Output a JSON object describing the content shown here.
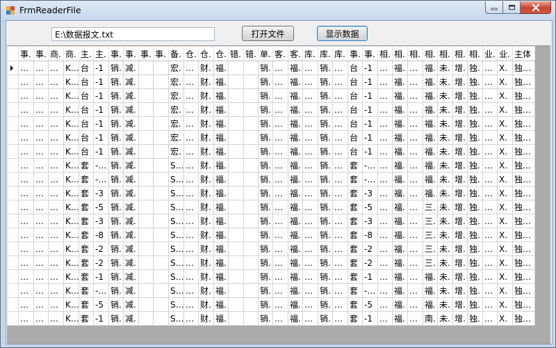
{
  "window": {
    "title": "FrmReaderFile"
  },
  "toolbar": {
    "file_path": "E:\\数据报文.txt",
    "open_button": "打开文件",
    "show_button": "显示数据"
  },
  "grid": {
    "columns": [
      "事.",
      "事.",
      "商.",
      "商.",
      "主.",
      "主.",
      "事.",
      "事.",
      "事.",
      "事.",
      "备.",
      "仓.",
      "仓.",
      "仓.",
      "错.",
      "错.",
      "单.",
      "客.",
      "客.",
      "库.",
      "库.",
      "库.",
      "事.",
      "事.",
      "相.",
      "相.",
      "相.",
      "相.",
      "相.",
      "相.",
      "相.",
      "业.",
      "业.",
      "主体"
    ],
    "current_row": 0,
    "rows": [
      [
        "…",
        "…",
        "…",
        "K…",
        "台",
        "-1",
        "销.",
        "减.",
        "",
        "",
        "宏.",
        "…",
        "财.",
        "福.",
        "",
        "",
        "销.",
        "…",
        "福.",
        "…",
        "销.",
        "…",
        "台",
        "-1",
        "…",
        "福.",
        "…",
        "福.",
        "未.",
        "增.",
        "独.",
        "…",
        "X.",
        "独…"
      ],
      [
        "…",
        "…",
        "…",
        "K…",
        "台",
        "-1",
        "销.",
        "减.",
        "",
        "",
        "宏.",
        "…",
        "财.",
        "福.",
        "",
        "",
        "销.",
        "…",
        "福.",
        "…",
        "销.",
        "…",
        "台",
        "-1",
        "…",
        "福.",
        "…",
        "福.",
        "未.",
        "增.",
        "独.",
        "…",
        "X.",
        "独…"
      ],
      [
        "…",
        "…",
        "…",
        "K…",
        "台",
        "-1",
        "销.",
        "减.",
        "",
        "",
        "宏.",
        "…",
        "财.",
        "福.",
        "",
        "",
        "销.",
        "…",
        "福.",
        "…",
        "销.",
        "…",
        "台",
        "-1",
        "…",
        "福.",
        "…",
        "福.",
        "未.",
        "增.",
        "独.",
        "…",
        "X.",
        "独…"
      ],
      [
        "…",
        "…",
        "…",
        "K…",
        "台",
        "-1",
        "销.",
        "减.",
        "",
        "",
        "宏.",
        "…",
        "财.",
        "福.",
        "",
        "",
        "销.",
        "…",
        "福.",
        "…",
        "销.",
        "…",
        "台",
        "-1",
        "…",
        "福.",
        "…",
        "福.",
        "未.",
        "增.",
        "独.",
        "…",
        "X.",
        "独…"
      ],
      [
        "…",
        "…",
        "…",
        "K…",
        "台",
        "-1",
        "销.",
        "减.",
        "",
        "",
        "宏.",
        "…",
        "财.",
        "福.",
        "",
        "",
        "销.",
        "…",
        "福.",
        "…",
        "销.",
        "…",
        "台",
        "-1",
        "…",
        "福.",
        "…",
        "福.",
        "未.",
        "增.",
        "独.",
        "…",
        "X.",
        "独…"
      ],
      [
        "…",
        "…",
        "…",
        "K…",
        "台",
        "-1",
        "销.",
        "减.",
        "",
        "",
        "宏.",
        "…",
        "财.",
        "福.",
        "",
        "",
        "销.",
        "…",
        "福.",
        "…",
        "销.",
        "…",
        "台",
        "-1",
        "…",
        "福.",
        "…",
        "福.",
        "未.",
        "增.",
        "独.",
        "…",
        "X.",
        "独…"
      ],
      [
        "…",
        "…",
        "…",
        "K…",
        "台",
        "-1",
        "销.",
        "减.",
        "",
        "",
        "宏.",
        "…",
        "财.",
        "福.",
        "",
        "",
        "销.",
        "…",
        "福.",
        "…",
        "销.",
        "…",
        "台",
        "-1",
        "…",
        "福.",
        "…",
        "福.",
        "未.",
        "增.",
        "独.",
        "…",
        "X.",
        "独…"
      ],
      [
        "…",
        "…",
        "…",
        "K…",
        "套",
        "-…",
        "销.",
        "减.",
        "",
        "",
        "S…",
        "…",
        "财.",
        "福.",
        "",
        "",
        "销.",
        "…",
        "福.",
        "…",
        "销.",
        "…",
        "套",
        "-…",
        "…",
        "福.",
        "…",
        "福.",
        "未.",
        "增.",
        "独.",
        "…",
        "X.",
        "独…"
      ],
      [
        "…",
        "…",
        "…",
        "K…",
        "套",
        "-…",
        "销.",
        "减.",
        "",
        "",
        "S…",
        "…",
        "财.",
        "福.",
        "",
        "",
        "销.",
        "…",
        "福.",
        "…",
        "销.",
        "…",
        "套",
        "-…",
        "…",
        "福.",
        "…",
        "福.",
        "未.",
        "增.",
        "独.",
        "…",
        "X.",
        "独…"
      ],
      [
        "…",
        "…",
        "…",
        "K…",
        "套",
        "-3",
        "销.",
        "减.",
        "",
        "",
        "S…",
        "…",
        "财.",
        "福.",
        "",
        "",
        "销.",
        "…",
        "福.",
        "…",
        "销.",
        "…",
        "套",
        "-3",
        "…",
        "福.",
        "…",
        "福.",
        "未.",
        "增.",
        "独.",
        "…",
        "X.",
        "独…"
      ],
      [
        "…",
        "…",
        "…",
        "K…",
        "套",
        "-5",
        "销.",
        "减.",
        "",
        "",
        "S…",
        "…",
        "财.",
        "福.",
        "",
        "",
        "销.",
        "…",
        "福.",
        "…",
        "销.",
        "…",
        "套",
        "-5",
        "…",
        "福.",
        "…",
        "三.",
        "未.",
        "增.",
        "独.",
        "…",
        "X.",
        "独…"
      ],
      [
        "…",
        "…",
        "…",
        "K…",
        "套",
        "-3",
        "销.",
        "减.",
        "",
        "",
        "S…",
        "…",
        "财.",
        "福.",
        "",
        "",
        "销.",
        "…",
        "福.",
        "…",
        "销.",
        "…",
        "套",
        "-3",
        "…",
        "福.",
        "…",
        "三.",
        "未.",
        "增.",
        "独.",
        "…",
        "X.",
        "独…"
      ],
      [
        "…",
        "…",
        "…",
        "K…",
        "套",
        "-8",
        "销.",
        "减.",
        "",
        "",
        "S…",
        "…",
        "财.",
        "福.",
        "",
        "",
        "销.",
        "…",
        "福.",
        "…",
        "销.",
        "…",
        "套",
        "-8",
        "…",
        "福.",
        "…",
        "三.",
        "未.",
        "增.",
        "独.",
        "…",
        "X.",
        "独…"
      ],
      [
        "…",
        "…",
        "…",
        "K…",
        "套",
        "-2",
        "销.",
        "减.",
        "",
        "",
        "S…",
        "…",
        "财.",
        "福.",
        "",
        "",
        "销.",
        "…",
        "福.",
        "…",
        "销.",
        "…",
        "套",
        "-2",
        "…",
        "福.",
        "…",
        "三.",
        "未.",
        "增.",
        "独.",
        "…",
        "X.",
        "独…"
      ],
      [
        "…",
        "…",
        "…",
        "K…",
        "套",
        "-2",
        "销.",
        "减.",
        "",
        "",
        "S…",
        "…",
        "财.",
        "福.",
        "",
        "",
        "销.",
        "…",
        "福.",
        "…",
        "销.",
        "…",
        "套",
        "-2",
        "…",
        "福.",
        "…",
        "三.",
        "未.",
        "增.",
        "独.",
        "…",
        "X.",
        "独…"
      ],
      [
        "…",
        "…",
        "…",
        "K…",
        "套",
        "-1",
        "销.",
        "减.",
        "",
        "",
        "S…",
        "…",
        "财.",
        "福.",
        "",
        "",
        "销.",
        "…",
        "福.",
        "…",
        "销.",
        "…",
        "套",
        "-1",
        "…",
        "福.",
        "…",
        "福.",
        "未.",
        "增.",
        "独.",
        "…",
        "X.",
        "独…"
      ],
      [
        "…",
        "…",
        "…",
        "K…",
        "套",
        "-…",
        "销.",
        "减.",
        "",
        "",
        "S…",
        "…",
        "财.",
        "福.",
        "",
        "",
        "销.",
        "…",
        "福.",
        "…",
        "销.",
        "…",
        "套",
        "-…",
        "…",
        "福.",
        "…",
        "福.",
        "未.",
        "增.",
        "独.",
        "…",
        "X.",
        "独…"
      ],
      [
        "…",
        "…",
        "…",
        "K…",
        "套",
        "-5",
        "销.",
        "减.",
        "",
        "",
        "S…",
        "…",
        "财.",
        "福.",
        "",
        "",
        "销.",
        "…",
        "福.",
        "…",
        "销.",
        "…",
        "套",
        "-5",
        "…",
        "福.",
        "…",
        "福.",
        "未.",
        "增.",
        "独.",
        "…",
        "X.",
        "独…"
      ],
      [
        "…",
        "…",
        "…",
        "K…",
        "套",
        "-1",
        "销.",
        "减.",
        "",
        "",
        "S…",
        "…",
        "财.",
        "福.",
        "",
        "",
        "销.",
        "…",
        "福.",
        "…",
        "销.",
        "…",
        "套",
        "-1",
        "…",
        "福.",
        "…",
        "南.",
        "未.",
        "增.",
        "独.",
        "…",
        "X.",
        "独…"
      ]
    ]
  },
  "colors": {
    "title_bg": "#c6d7ec",
    "close_btn": "#c6452f",
    "grid_line": "#d3d3d3",
    "grid_bg": "#ffffff",
    "empty_area": "#ababab"
  },
  "icons": {
    "app": "app-icon",
    "minimize": "minimize-icon",
    "maximize": "maximize-icon",
    "close": "close-icon",
    "current_row": "row-pointer-icon"
  }
}
